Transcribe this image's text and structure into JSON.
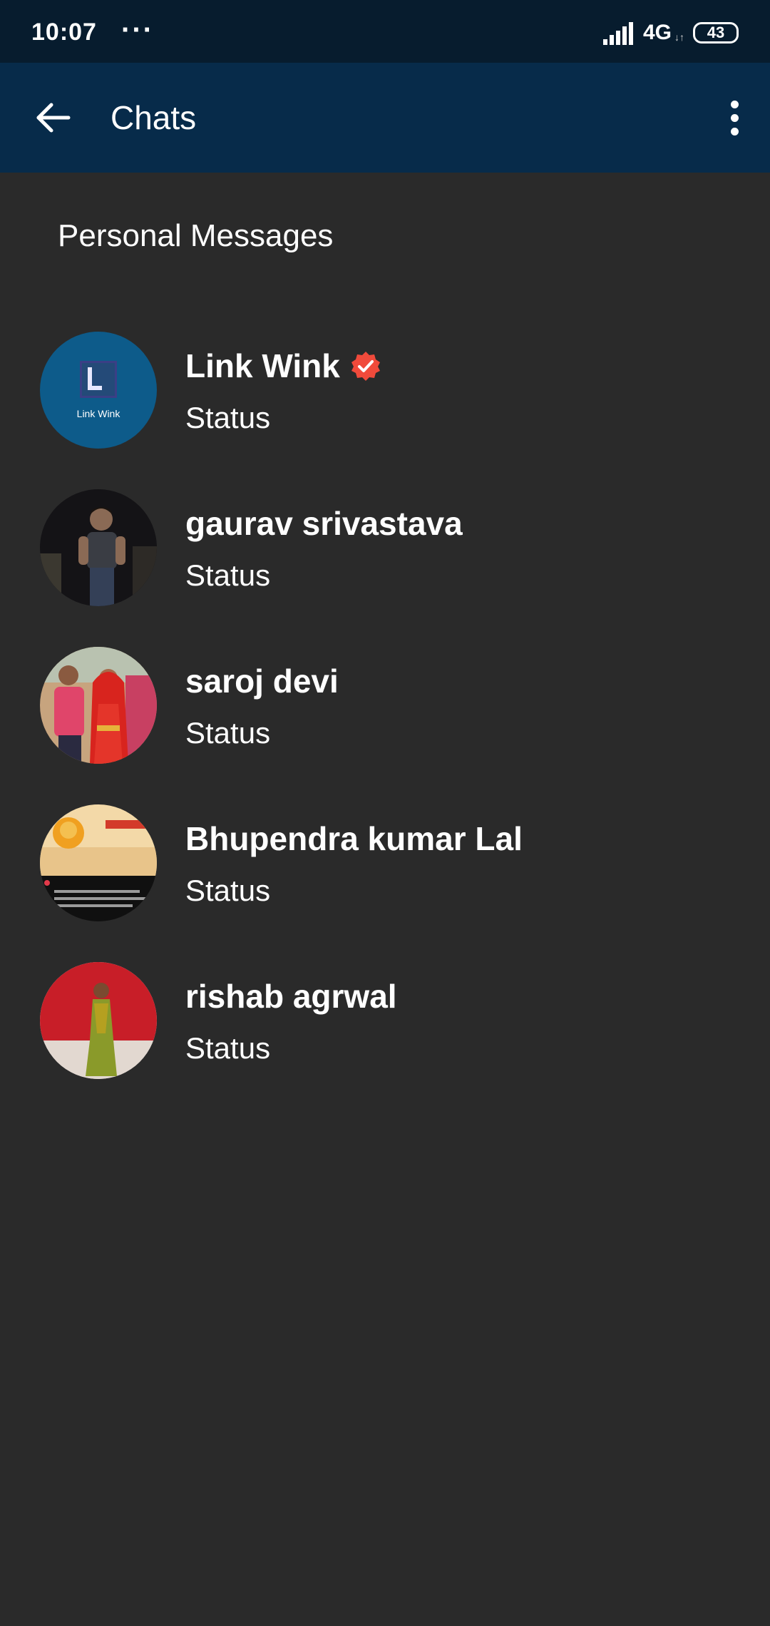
{
  "status_bar": {
    "time": "10:07",
    "dots": "···",
    "network": "4G",
    "network_arrows": "↓↑",
    "battery": "43"
  },
  "app_bar": {
    "title": "Chats"
  },
  "section": {
    "title": "Personal Messages"
  },
  "chats": [
    {
      "name": "Link Wink",
      "status": "Status",
      "verified": true,
      "avatar_text": "Link Wink"
    },
    {
      "name": "gaurav srivastava",
      "status": "Status",
      "verified": false
    },
    {
      "name": "saroj devi",
      "status": "Status",
      "verified": false
    },
    {
      "name": "Bhupendra kumar Lal",
      "status": "Status",
      "verified": false
    },
    {
      "name": "rishab agrwal",
      "status": "Status",
      "verified": false
    }
  ],
  "colors": {
    "status_bar_bg": "#071c2e",
    "app_bar_bg": "#072b4a",
    "page_bg": "#2a2a2a",
    "verified_badge": "#f04a3b"
  },
  "icons": {
    "back": "back-arrow-icon",
    "more": "more-vertical-icon",
    "verified": "verified-badge-icon",
    "signal": "signal-icon",
    "battery": "battery-icon"
  }
}
